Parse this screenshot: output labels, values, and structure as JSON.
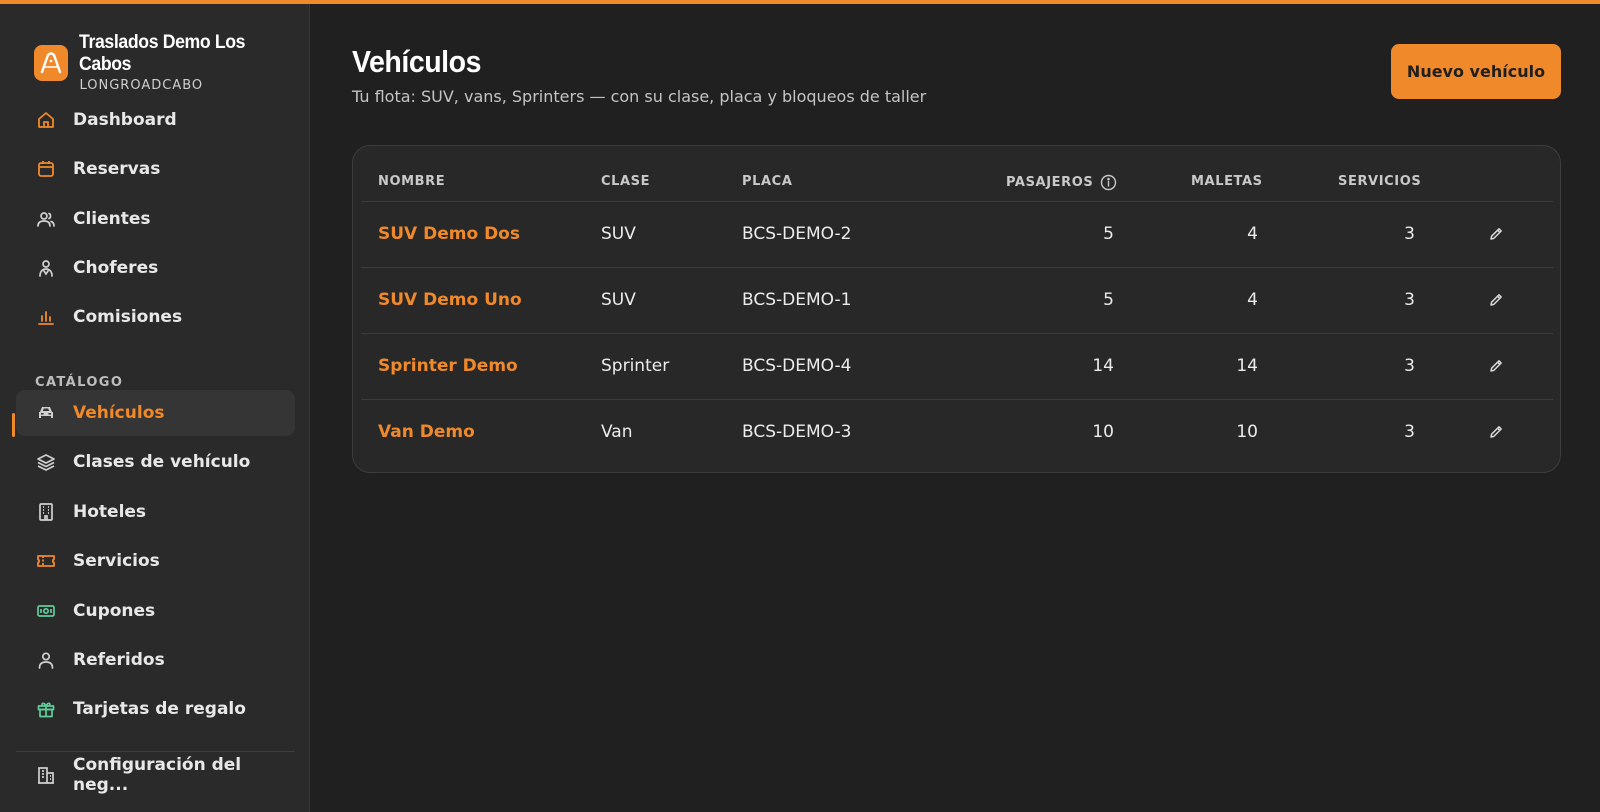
{
  "brand": {
    "name": "Traslados Demo Los Cabos",
    "sub": "LONGROADCABO",
    "icon": "road-arch-icon",
    "accent": "#f0892a"
  },
  "nav": {
    "items": [
      {
        "label": "Dashboard",
        "icon": "home-icon"
      },
      {
        "label": "Reservas",
        "icon": "calendar-icon"
      },
      {
        "label": "Clientes",
        "icon": "users-icon"
      },
      {
        "label": "Choferes",
        "icon": "driver-icon"
      },
      {
        "label": "Comisiones",
        "icon": "bar-chart-icon"
      }
    ],
    "section_label": "CATÁLOGO",
    "catalog": [
      {
        "label": "Vehículos",
        "icon": "car-icon",
        "active": true
      },
      {
        "label": "Clases de vehículo",
        "icon": "layers-icon"
      },
      {
        "label": "Hoteles",
        "icon": "building-icon"
      },
      {
        "label": "Servicios",
        "icon": "ticket-icon"
      },
      {
        "label": "Cupones",
        "icon": "coupon-icon"
      },
      {
        "label": "Referidos",
        "icon": "user-icon"
      },
      {
        "label": "Tarjetas de regalo",
        "icon": "gift-icon"
      }
    ],
    "footer": {
      "label": "Configuración del neg...",
      "icon": "office-building-icon"
    }
  },
  "page": {
    "title": "Vehículos",
    "subtitle": "Tu flota: SUV, vans, Sprinters — con su clase, placa y bloqueos de taller",
    "new_button": "Nuevo vehículo"
  },
  "table": {
    "headers": {
      "name": "NOMBRE",
      "class": "CLASE",
      "plate": "PLACA",
      "passengers": "PASAJEROS",
      "luggage": "MALETAS",
      "services": "SERVICIOS"
    },
    "rows": [
      {
        "name": "SUV Demo Dos",
        "class": "SUV",
        "plate": "BCS-DEMO-2",
        "passengers": "5",
        "luggage": "4",
        "services": "3"
      },
      {
        "name": "SUV Demo Uno",
        "class": "SUV",
        "plate": "BCS-DEMO-1",
        "passengers": "5",
        "luggage": "4",
        "services": "3"
      },
      {
        "name": "Sprinter Demo",
        "class": "Sprinter",
        "plate": "BCS-DEMO-4",
        "passengers": "14",
        "luggage": "14",
        "services": "3"
      },
      {
        "name": "Van Demo",
        "class": "Van",
        "plate": "BCS-DEMO-3",
        "passengers": "10",
        "luggage": "10",
        "services": "3"
      }
    ]
  },
  "colors": {
    "accent": "#f0892a",
    "teal_icon": "#5fcf9a",
    "background": "#202020",
    "sidebar": "#2a2a2a"
  }
}
